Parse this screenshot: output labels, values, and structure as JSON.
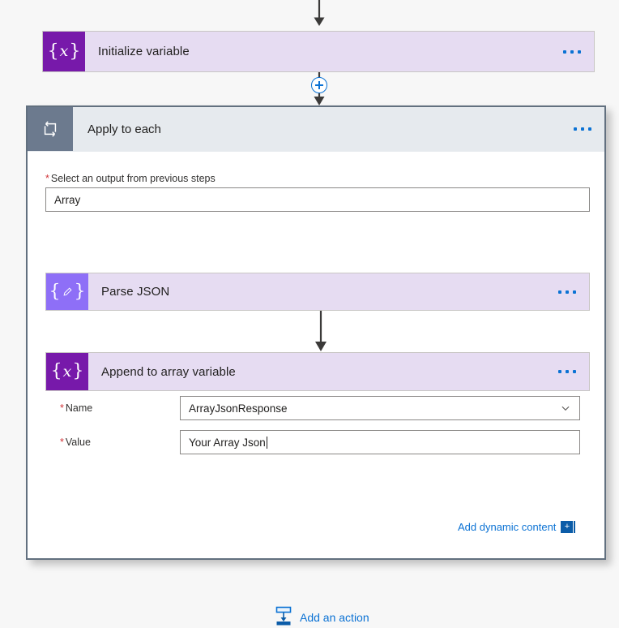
{
  "canvas": {
    "background_color": "#f7f7f7"
  },
  "colors": {
    "variable_icon": "#7719aa",
    "parse_json_icon": "#8e6ff7",
    "scope_icon": "#6c7a8e",
    "card_body": "#e6dcf2",
    "scope_header": "#e6eaee",
    "accent_blue": "#0b72d4",
    "required_red": "#d13438",
    "connector": "#3b3a39"
  },
  "steps": {
    "initialize_variable": {
      "title": "Initialize variable",
      "icon": "variable-braces-x-icon",
      "menu": "more-options-icon"
    },
    "apply_to_each": {
      "title": "Apply to each",
      "icon": "loop-repeat-icon",
      "menu": "more-options-icon",
      "output_field": {
        "required_marker": "*",
        "label": "Select an output from previous steps",
        "value": "Array"
      }
    },
    "parse_json": {
      "title": "Parse JSON",
      "icon": "parse-json-braces-pencil-icon",
      "menu": "more-options-icon"
    },
    "append_to_array": {
      "title": "Append to array variable",
      "icon": "variable-braces-x-icon",
      "menu": "more-options-icon",
      "name_field": {
        "required_marker": "*",
        "label": "Name",
        "value": "ArrayJsonResponse",
        "dropdown_icon": "chevron-down-icon"
      },
      "value_field": {
        "required_marker": "*",
        "label": "Value",
        "value": "Your Array Json",
        "has_caret": true
      },
      "dynamic_content": {
        "label": "Add dynamic content",
        "badge": "+",
        "icon": "add-dynamic-content-icon"
      }
    },
    "add_action": {
      "label": "Add an action",
      "icon": "insert-action-icon"
    },
    "insert_node": {
      "icon": "plus-circle-icon",
      "label": "+"
    }
  }
}
